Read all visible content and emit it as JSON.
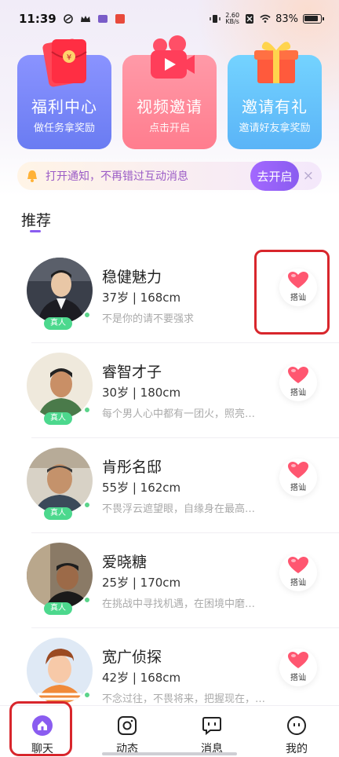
{
  "status_bar": {
    "time": "11:39",
    "net_speed_value": "2.60",
    "net_speed_unit": "KB/s",
    "battery": "83%"
  },
  "cards": [
    {
      "title": "福利中心",
      "subtitle": "做任务拿奖励",
      "icon": "red-envelope-icon"
    },
    {
      "title": "视频邀请",
      "subtitle": "点击开启",
      "icon": "video-camera-icon"
    },
    {
      "title": "邀请有礼",
      "subtitle": "邀请好友拿奖励",
      "icon": "gift-box-icon"
    }
  ],
  "notice": {
    "text": "打开通知，不再错过互动消息",
    "button": "去开启",
    "close": "×"
  },
  "section": {
    "title": "推荐"
  },
  "users": [
    {
      "name": "稳健魅力",
      "meta": "37岁 | 168cm",
      "signature": "不是你的请不要强求",
      "badge": "真人",
      "action": "搭讪"
    },
    {
      "name": "睿智才子",
      "meta": "30岁 | 180cm",
      "signature": "每个男人心中都有一团火，照亮…",
      "badge": "真人",
      "action": "搭讪"
    },
    {
      "name": "肯彤名邸",
      "meta": "55岁 | 162cm",
      "signature": "不畏浮云遮望眼，自缘身在最高…",
      "badge": "真人",
      "action": "搭讪"
    },
    {
      "name": "爱晓糖",
      "meta": "25岁 | 170cm",
      "signature": "在挑战中寻找机遇，在困境中磨…",
      "badge": "真人",
      "action": "搭讪"
    },
    {
      "name": "宽广侦探",
      "meta": "42岁 | 168cm",
      "signature": "不念过往，不畏将来，把握现在，…",
      "badge": "",
      "action": "搭讪"
    }
  ],
  "nav": [
    {
      "label": "聊天",
      "icon": "home-icon"
    },
    {
      "label": "动态",
      "icon": "camera-icon"
    },
    {
      "label": "消息",
      "icon": "message-icon"
    },
    {
      "label": "我的",
      "icon": "profile-icon"
    }
  ],
  "colors": {
    "accent": "#8a5cf0",
    "online": "#5bd48a",
    "highlight": "#d8262c"
  }
}
